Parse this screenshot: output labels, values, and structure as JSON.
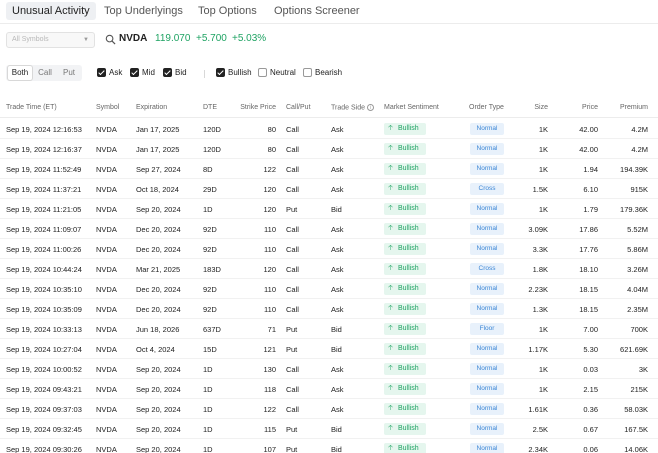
{
  "tabs": [
    {
      "label": "Unusual Activity",
      "active": true
    },
    {
      "label": "Top Underlyings",
      "active": false
    },
    {
      "label": "Top Options",
      "active": false
    },
    {
      "label": "Options Screener",
      "active": false
    }
  ],
  "symbol_select": {
    "placeholder": "All Symbols"
  },
  "quote": {
    "ticker": "NVDA",
    "price": "119.070",
    "change": "+5.700",
    "change_pct": "+5.03%"
  },
  "type_filter": {
    "options": [
      "Both",
      "Call",
      "Put"
    ],
    "selected": "Both"
  },
  "side_filters": [
    {
      "label": "Ask",
      "checked": true
    },
    {
      "label": "Mid",
      "checked": true
    },
    {
      "label": "Bid",
      "checked": true
    }
  ],
  "sentiment_filters": [
    {
      "label": "Bullish",
      "checked": true
    },
    {
      "label": "Neutral",
      "checked": false
    },
    {
      "label": "Bearish",
      "checked": false
    }
  ],
  "columns": {
    "trade_time": "Trade Time (ET)",
    "symbol": "Symbol",
    "expiration": "Expiration",
    "dte": "DTE",
    "strike": "Strike Price",
    "callput": "Call/Put",
    "side": "Trade Side",
    "sentiment": "Market Sentiment",
    "order_type": "Order Type",
    "size": "Size",
    "price": "Price",
    "premium": "Premium"
  },
  "rows": [
    {
      "time": "Sep 19, 2024 12:16:53",
      "symbol": "NVDA",
      "expiration": "Jan 17, 2025",
      "dte": "120D",
      "strike": "80",
      "callput": "Call",
      "side": "Ask",
      "sentiment": "Bullish",
      "order_type": "Normal",
      "size": "1K",
      "price": "42.00",
      "premium": "4.2M"
    },
    {
      "time": "Sep 19, 2024 12:16:37",
      "symbol": "NVDA",
      "expiration": "Jan 17, 2025",
      "dte": "120D",
      "strike": "80",
      "callput": "Call",
      "side": "Ask",
      "sentiment": "Bullish",
      "order_type": "Normal",
      "size": "1K",
      "price": "42.00",
      "premium": "4.2M"
    },
    {
      "time": "Sep 19, 2024 11:52:49",
      "symbol": "NVDA",
      "expiration": "Sep 27, 2024",
      "dte": "8D",
      "strike": "122",
      "callput": "Call",
      "side": "Ask",
      "sentiment": "Bullish",
      "order_type": "Normal",
      "size": "1K",
      "price": "1.94",
      "premium": "194.39K"
    },
    {
      "time": "Sep 19, 2024 11:37:21",
      "symbol": "NVDA",
      "expiration": "Oct 18, 2024",
      "dte": "29D",
      "strike": "120",
      "callput": "Call",
      "side": "Ask",
      "sentiment": "Bullish",
      "order_type": "Cross",
      "size": "1.5K",
      "price": "6.10",
      "premium": "915K"
    },
    {
      "time": "Sep 19, 2024 11:21:05",
      "symbol": "NVDA",
      "expiration": "Sep 20, 2024",
      "dte": "1D",
      "strike": "120",
      "callput": "Put",
      "side": "Bid",
      "sentiment": "Bullish",
      "order_type": "Normal",
      "size": "1K",
      "price": "1.79",
      "premium": "179.36K"
    },
    {
      "time": "Sep 19, 2024 11:09:07",
      "symbol": "NVDA",
      "expiration": "Dec 20, 2024",
      "dte": "92D",
      "strike": "110",
      "callput": "Call",
      "side": "Ask",
      "sentiment": "Bullish",
      "order_type": "Normal",
      "size": "3.09K",
      "price": "17.86",
      "premium": "5.52M"
    },
    {
      "time": "Sep 19, 2024 11:00:26",
      "symbol": "NVDA",
      "expiration": "Dec 20, 2024",
      "dte": "92D",
      "strike": "110",
      "callput": "Call",
      "side": "Ask",
      "sentiment": "Bullish",
      "order_type": "Normal",
      "size": "3.3K",
      "price": "17.76",
      "premium": "5.86M"
    },
    {
      "time": "Sep 19, 2024 10:44:24",
      "symbol": "NVDA",
      "expiration": "Mar 21, 2025",
      "dte": "183D",
      "strike": "120",
      "callput": "Call",
      "side": "Ask",
      "sentiment": "Bullish",
      "order_type": "Cross",
      "size": "1.8K",
      "price": "18.10",
      "premium": "3.26M"
    },
    {
      "time": "Sep 19, 2024 10:35:10",
      "symbol": "NVDA",
      "expiration": "Dec 20, 2024",
      "dte": "92D",
      "strike": "110",
      "callput": "Call",
      "side": "Ask",
      "sentiment": "Bullish",
      "order_type": "Normal",
      "size": "2.23K",
      "price": "18.15",
      "premium": "4.04M"
    },
    {
      "time": "Sep 19, 2024 10:35:09",
      "symbol": "NVDA",
      "expiration": "Dec 20, 2024",
      "dte": "92D",
      "strike": "110",
      "callput": "Call",
      "side": "Ask",
      "sentiment": "Bullish",
      "order_type": "Normal",
      "size": "1.3K",
      "price": "18.15",
      "premium": "2.35M"
    },
    {
      "time": "Sep 19, 2024 10:33:13",
      "symbol": "NVDA",
      "expiration": "Jun 18, 2026",
      "dte": "637D",
      "strike": "71",
      "callput": "Put",
      "side": "Bid",
      "sentiment": "Bullish",
      "order_type": "Floor",
      "size": "1K",
      "price": "7.00",
      "premium": "700K"
    },
    {
      "time": "Sep 19, 2024 10:27:04",
      "symbol": "NVDA",
      "expiration": "Oct 4, 2024",
      "dte": "15D",
      "strike": "121",
      "callput": "Put",
      "side": "Bid",
      "sentiment": "Bullish",
      "order_type": "Normal",
      "size": "1.17K",
      "price": "5.30",
      "premium": "621.69K"
    },
    {
      "time": "Sep 19, 2024 10:00:52",
      "symbol": "NVDA",
      "expiration": "Sep 20, 2024",
      "dte": "1D",
      "strike": "130",
      "callput": "Call",
      "side": "Ask",
      "sentiment": "Bullish",
      "order_type": "Normal",
      "size": "1K",
      "price": "0.03",
      "premium": "3K"
    },
    {
      "time": "Sep 19, 2024 09:43:21",
      "symbol": "NVDA",
      "expiration": "Sep 20, 2024",
      "dte": "1D",
      "strike": "118",
      "callput": "Call",
      "side": "Ask",
      "sentiment": "Bullish",
      "order_type": "Normal",
      "size": "1K",
      "price": "2.15",
      "premium": "215K"
    },
    {
      "time": "Sep 19, 2024 09:37:03",
      "symbol": "NVDA",
      "expiration": "Sep 20, 2024",
      "dte": "1D",
      "strike": "122",
      "callput": "Call",
      "side": "Ask",
      "sentiment": "Bullish",
      "order_type": "Normal",
      "size": "1.61K",
      "price": "0.36",
      "premium": "58.03K"
    },
    {
      "time": "Sep 19, 2024 09:32:45",
      "symbol": "NVDA",
      "expiration": "Sep 20, 2024",
      "dte": "1D",
      "strike": "115",
      "callput": "Put",
      "side": "Bid",
      "sentiment": "Bullish",
      "order_type": "Normal",
      "size": "2.5K",
      "price": "0.67",
      "premium": "167.5K"
    },
    {
      "time": "Sep 19, 2024 09:30:26",
      "symbol": "NVDA",
      "expiration": "Sep 20, 2024",
      "dte": "1D",
      "strike": "107",
      "callput": "Put",
      "side": "Bid",
      "sentiment": "Bullish",
      "order_type": "Normal",
      "size": "2.34K",
      "price": "0.06",
      "premium": "14.06K"
    }
  ],
  "colors": {
    "positive": "#1fa363",
    "bullish_bg": "#e5f6ee",
    "order_type_text": "#3b86d6",
    "order_type_bg": "#e8f1fb"
  }
}
